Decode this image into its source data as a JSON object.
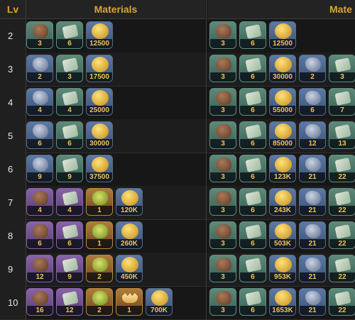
{
  "headers": {
    "lv": "Lv",
    "materials": "Materials",
    "materials_next": "Mate"
  },
  "rows": [
    {
      "lv": "2",
      "left": [
        {
          "icon": "wood-icon",
          "q": "green",
          "v": "3"
        },
        {
          "icon": "cloth-icon",
          "q": "green",
          "v": "6"
        },
        {
          "icon": "gold-coin-icon",
          "q": "blue",
          "v": "12500"
        }
      ],
      "right": [
        {
          "icon": "wood-icon",
          "q": "green",
          "v": "3"
        },
        {
          "icon": "cloth-icon",
          "q": "green",
          "v": "6"
        },
        {
          "icon": "gold-coin-icon",
          "q": "blue",
          "v": "12500"
        }
      ]
    },
    {
      "lv": "3",
      "left": [
        {
          "icon": "ore-icon",
          "q": "blue",
          "v": "2"
        },
        {
          "icon": "cloth-icon",
          "q": "green",
          "v": "3"
        },
        {
          "icon": "gold-coin-icon",
          "q": "blue",
          "v": "17500"
        }
      ],
      "right": [
        {
          "icon": "wood-icon",
          "q": "green",
          "v": "3"
        },
        {
          "icon": "cloth-icon",
          "q": "green",
          "v": "6"
        },
        {
          "icon": "gold-coin-icon",
          "q": "blue",
          "v": "30000"
        },
        {
          "icon": "ore-icon",
          "q": "blue",
          "v": "2"
        },
        {
          "icon": "cloth-icon",
          "q": "green",
          "v": "3"
        }
      ]
    },
    {
      "lv": "4",
      "left": [
        {
          "icon": "ore-icon",
          "q": "blue",
          "v": "4"
        },
        {
          "icon": "cloth-icon",
          "q": "green",
          "v": "4"
        },
        {
          "icon": "gold-coin-icon",
          "q": "blue",
          "v": "25000"
        }
      ],
      "right": [
        {
          "icon": "wood-icon",
          "q": "green",
          "v": "3"
        },
        {
          "icon": "cloth-icon",
          "q": "green",
          "v": "6"
        },
        {
          "icon": "gold-coin-icon",
          "q": "blue",
          "v": "55000"
        },
        {
          "icon": "ore-icon",
          "q": "blue",
          "v": "6"
        },
        {
          "icon": "cloth-icon",
          "q": "green",
          "v": "7"
        }
      ]
    },
    {
      "lv": "5",
      "left": [
        {
          "icon": "ore-icon",
          "q": "blue",
          "v": "6"
        },
        {
          "icon": "cloth-icon",
          "q": "green",
          "v": "6"
        },
        {
          "icon": "gold-coin-icon",
          "q": "blue",
          "v": "30000"
        }
      ],
      "right": [
        {
          "icon": "wood-icon",
          "q": "green",
          "v": "3"
        },
        {
          "icon": "cloth-icon",
          "q": "green",
          "v": "6"
        },
        {
          "icon": "gold-coin-icon",
          "q": "blue",
          "v": "85000"
        },
        {
          "icon": "ore-icon",
          "q": "blue",
          "v": "12"
        },
        {
          "icon": "cloth-icon",
          "q": "green",
          "v": "13"
        }
      ]
    },
    {
      "lv": "6",
      "left": [
        {
          "icon": "ore-icon",
          "q": "blue",
          "v": "9"
        },
        {
          "icon": "cloth-icon",
          "q": "green",
          "v": "9"
        },
        {
          "icon": "gold-coin-icon",
          "q": "blue",
          "v": "37500"
        }
      ],
      "right": [
        {
          "icon": "wood-icon",
          "q": "green",
          "v": "3"
        },
        {
          "icon": "cloth-icon",
          "q": "green",
          "v": "6"
        },
        {
          "icon": "gold-coin-icon",
          "q": "blue",
          "v": "123K"
        },
        {
          "icon": "ore-icon",
          "q": "blue",
          "v": "21"
        },
        {
          "icon": "cloth-icon",
          "q": "green",
          "v": "22"
        }
      ]
    },
    {
      "lv": "7",
      "left": [
        {
          "icon": "wood-icon",
          "q": "purple",
          "v": "4"
        },
        {
          "icon": "cloth-icon",
          "q": "purple",
          "v": "4"
        },
        {
          "icon": "moss-icon",
          "q": "orange",
          "v": "1"
        },
        {
          "icon": "gold-coin-icon",
          "q": "blue",
          "v": "120K"
        }
      ],
      "right": [
        {
          "icon": "wood-icon",
          "q": "green",
          "v": "3"
        },
        {
          "icon": "cloth-icon",
          "q": "green",
          "v": "6"
        },
        {
          "icon": "gold-coin-icon",
          "q": "blue",
          "v": "243K"
        },
        {
          "icon": "ore-icon",
          "q": "blue",
          "v": "21"
        },
        {
          "icon": "cloth-icon",
          "q": "green",
          "v": "22"
        }
      ]
    },
    {
      "lv": "8",
      "left": [
        {
          "icon": "wood-icon",
          "q": "purple",
          "v": "6"
        },
        {
          "icon": "cloth-icon",
          "q": "purple",
          "v": "6"
        },
        {
          "icon": "moss-icon",
          "q": "orange",
          "v": "1"
        },
        {
          "icon": "gold-coin-icon",
          "q": "blue",
          "v": "260K"
        }
      ],
      "right": [
        {
          "icon": "wood-icon",
          "q": "green",
          "v": "3"
        },
        {
          "icon": "cloth-icon",
          "q": "green",
          "v": "6"
        },
        {
          "icon": "gold-coin-icon",
          "q": "blue",
          "v": "503K"
        },
        {
          "icon": "ore-icon",
          "q": "blue",
          "v": "21"
        },
        {
          "icon": "cloth-icon",
          "q": "green",
          "v": "22"
        }
      ]
    },
    {
      "lv": "9",
      "left": [
        {
          "icon": "wood-icon",
          "q": "purple",
          "v": "12"
        },
        {
          "icon": "cloth-icon",
          "q": "purple",
          "v": "9"
        },
        {
          "icon": "moss-icon",
          "q": "orange",
          "v": "2"
        },
        {
          "icon": "gold-coin-icon",
          "q": "blue",
          "v": "450K"
        }
      ],
      "right": [
        {
          "icon": "wood-icon",
          "q": "green",
          "v": "3"
        },
        {
          "icon": "cloth-icon",
          "q": "green",
          "v": "6"
        },
        {
          "icon": "gold-coin-icon",
          "q": "blue",
          "v": "953K"
        },
        {
          "icon": "ore-icon",
          "q": "blue",
          "v": "21"
        },
        {
          "icon": "cloth-icon",
          "q": "green",
          "v": "22"
        }
      ]
    },
    {
      "lv": "10",
      "left": [
        {
          "icon": "wood-icon",
          "q": "purple",
          "v": "16"
        },
        {
          "icon": "cloth-icon",
          "q": "purple",
          "v": "12"
        },
        {
          "icon": "moss-icon",
          "q": "orange",
          "v": "2"
        },
        {
          "icon": "crown-icon",
          "q": "orange",
          "v": "1"
        },
        {
          "icon": "gold-coin-icon",
          "q": "blue",
          "v": "700K"
        }
      ],
      "right": [
        {
          "icon": "wood-icon",
          "q": "green",
          "v": "3"
        },
        {
          "icon": "cloth-icon",
          "q": "green",
          "v": "6"
        },
        {
          "icon": "gold-coin-icon",
          "q": "blue",
          "v": "1653K"
        },
        {
          "icon": "ore-icon",
          "q": "blue",
          "v": "21"
        },
        {
          "icon": "cloth-icon",
          "q": "green",
          "v": "22"
        }
      ]
    }
  ]
}
